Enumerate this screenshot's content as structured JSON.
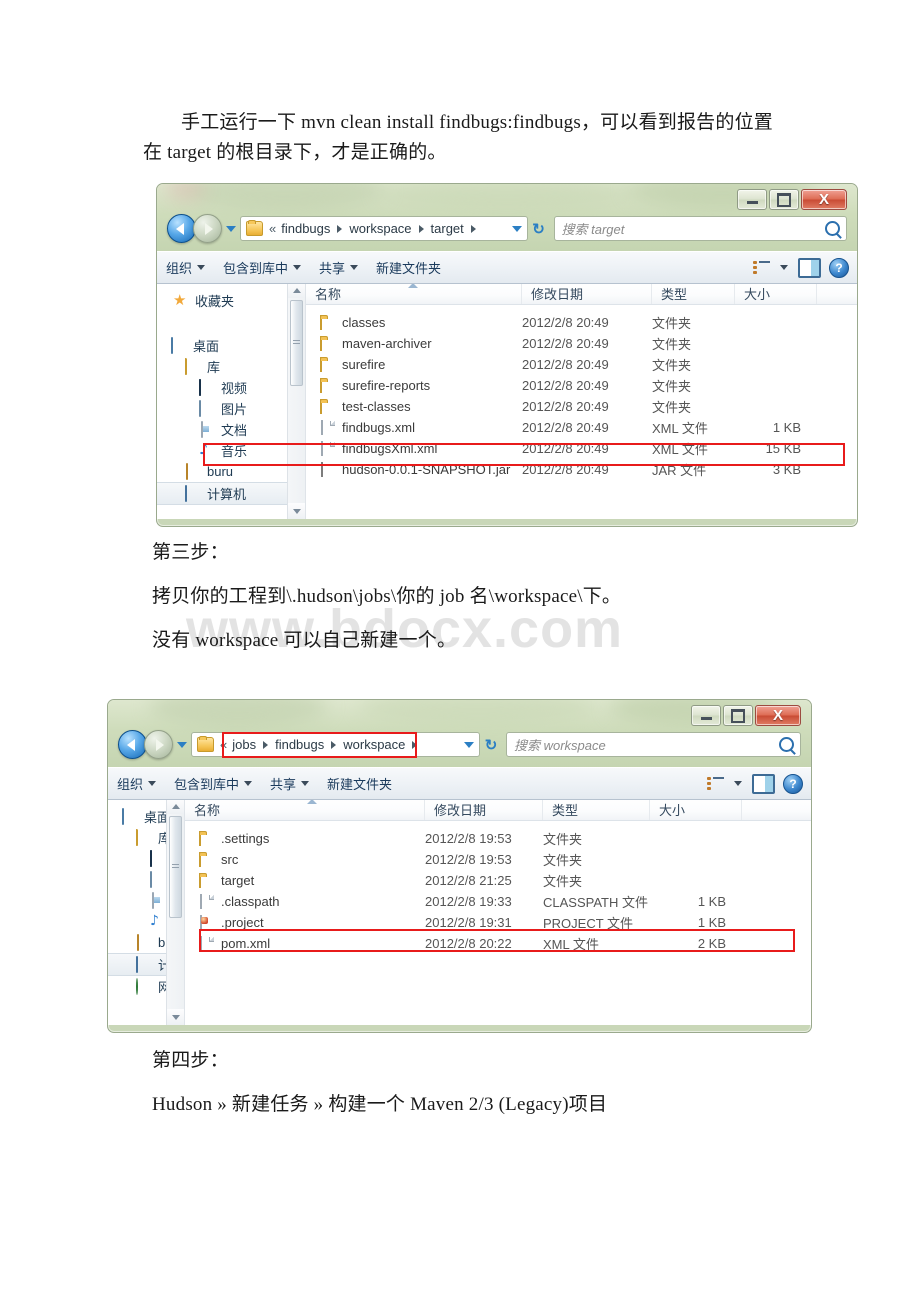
{
  "document": {
    "paragraphs": [
      {
        "id": "p1",
        "text": "手工运行一下 mvn clean install findbugs:findbugs，可以看到报告的位置在 target 的根目录下，才是正确的。"
      },
      {
        "id": "p2",
        "text": "第三步："
      },
      {
        "id": "p3",
        "text": "拷贝你的工程到\\.hudson\\jobs\\你的 job 名\\workspace\\下。"
      },
      {
        "id": "p4",
        "text": "没有 workspace 可以自己新建一个。"
      },
      {
        "id": "p5",
        "text": "第四步："
      },
      {
        "id": "p6",
        "text": "Hudson » 新建任务 » 构建一个 Maven 2/3 (Legacy)项目"
      }
    ],
    "watermark": "www.bdocx.com"
  },
  "explorer1": {
    "window_buttons": {
      "minimize": "—",
      "maximize": "□",
      "close": "X"
    },
    "address": {
      "chevron": "«",
      "crumbs": [
        "findbugs",
        "workspace",
        "target"
      ],
      "trailing_sep": true
    },
    "search": {
      "placeholder": "搜索 target"
    },
    "toolbar": {
      "items": [
        "组织",
        "包含到库中",
        "共享",
        "新建文件夹"
      ],
      "dropdown_items": [
        true,
        true,
        true,
        false
      ]
    },
    "navpane": [
      {
        "label": "收藏夹",
        "icon": "star-icon",
        "indent": 0,
        "selected": false
      },
      {
        "label": "",
        "icon": "spacer",
        "indent": 0,
        "selected": false
      },
      {
        "label": "桌面",
        "icon": "desktop-icon",
        "indent": 0,
        "selected": false
      },
      {
        "label": "库",
        "icon": "library-icon",
        "indent": 1,
        "selected": false
      },
      {
        "label": "视频",
        "icon": "video-icon",
        "indent": 2,
        "selected": false
      },
      {
        "label": "图片",
        "icon": "picture-icon",
        "indent": 2,
        "selected": false
      },
      {
        "label": "文档",
        "icon": "document-icon",
        "indent": 2,
        "selected": false
      },
      {
        "label": "音乐",
        "icon": "music-icon",
        "indent": 2,
        "selected": false
      },
      {
        "label": "buru",
        "icon": "user-icon",
        "indent": 1,
        "selected": false
      },
      {
        "label": "计算机",
        "icon": "computer-icon",
        "indent": 1,
        "selected": true
      }
    ],
    "columns": [
      "名称",
      "修改日期",
      "类型",
      "大小"
    ],
    "rows": [
      {
        "name": "classes",
        "icon": "folder-icon",
        "date": "2012/2/8 20:49",
        "type": "文件夹",
        "size": ""
      },
      {
        "name": "maven-archiver",
        "icon": "folder-icon",
        "date": "2012/2/8 20:49",
        "type": "文件夹",
        "size": ""
      },
      {
        "name": "surefire",
        "icon": "folder-icon",
        "date": "2012/2/8 20:49",
        "type": "文件夹",
        "size": ""
      },
      {
        "name": "surefire-reports",
        "icon": "folder-icon",
        "date": "2012/2/8 20:49",
        "type": "文件夹",
        "size": ""
      },
      {
        "name": "test-classes",
        "icon": "folder-icon",
        "date": "2012/2/8 20:49",
        "type": "文件夹",
        "size": ""
      },
      {
        "name": "findbugs.xml",
        "icon": "xml-file-icon",
        "date": "2012/2/8 20:49",
        "type": "XML 文件",
        "size": "1 KB"
      },
      {
        "name": "findbugsXml.xml",
        "icon": "xml-file-icon",
        "date": "2012/2/8 20:49",
        "type": "XML 文件",
        "size": "15 KB"
      },
      {
        "name": "hudson-0.0.1-SNAPSHOT.jar",
        "icon": "jar-file-icon",
        "date": "2012/2/8 20:49",
        "type": "JAR 文件",
        "size": "3 KB"
      }
    ],
    "highlight_row_index": 6
  },
  "explorer2": {
    "window_buttons": {
      "minimize": "—",
      "maximize": "□",
      "close": "X"
    },
    "address": {
      "chevron": "«",
      "crumbs": [
        "jobs",
        "findbugs",
        "workspace"
      ],
      "trailing_sep": true
    },
    "search": {
      "placeholder": "搜索 workspace"
    },
    "toolbar": {
      "items": [
        "组织",
        "包含到库中",
        "共享",
        "新建文件夹"
      ],
      "dropdown_items": [
        true,
        true,
        true,
        false
      ]
    },
    "navpane": [
      {
        "label": "桌面",
        "icon": "desktop-icon",
        "indent": 0,
        "selected": false
      },
      {
        "label": "库",
        "icon": "library-icon",
        "indent": 1,
        "selected": false
      },
      {
        "label": "",
        "icon": "video-icon",
        "indent": 2,
        "selected": false
      },
      {
        "label": "",
        "icon": "picture-icon",
        "indent": 2,
        "selected": false
      },
      {
        "label": "",
        "icon": "document-icon",
        "indent": 2,
        "selected": false
      },
      {
        "label": "",
        "icon": "music-icon",
        "indent": 2,
        "selected": false
      },
      {
        "label": "bu",
        "icon": "user-icon",
        "indent": 1,
        "selected": false
      },
      {
        "label": "计",
        "icon": "computer-icon",
        "indent": 1,
        "selected": true
      },
      {
        "label": "网",
        "icon": "network-icon",
        "indent": 1,
        "selected": false
      }
    ],
    "columns": [
      "名称",
      "修改日期",
      "类型",
      "大小"
    ],
    "rows": [
      {
        "name": ".settings",
        "icon": "folder-icon",
        "date": "2012/2/8 19:53",
        "type": "文件夹",
        "size": ""
      },
      {
        "name": "src",
        "icon": "folder-icon",
        "date": "2012/2/8 19:53",
        "type": "文件夹",
        "size": ""
      },
      {
        "name": "target",
        "icon": "folder-icon",
        "date": "2012/2/8 21:25",
        "type": "文件夹",
        "size": ""
      },
      {
        "name": ".classpath",
        "icon": "classpath-file-icon",
        "date": "2012/2/8 19:33",
        "type": "CLASSPATH 文件",
        "size": "1 KB"
      },
      {
        "name": ".project",
        "icon": "project-file-icon",
        "date": "2012/2/8 19:31",
        "type": "PROJECT 文件",
        "size": "1 KB"
      },
      {
        "name": "pom.xml",
        "icon": "xml-file-icon",
        "date": "2012/2/8 20:22",
        "type": "XML 文件",
        "size": "2 KB"
      }
    ],
    "highlight_row_index": 5
  },
  "colors": {
    "highlight_red": "#e81b1b",
    "aero_green": "#cfdcc0",
    "close_red": "#c94b34",
    "accent_blue": "#2b7fc4"
  }
}
